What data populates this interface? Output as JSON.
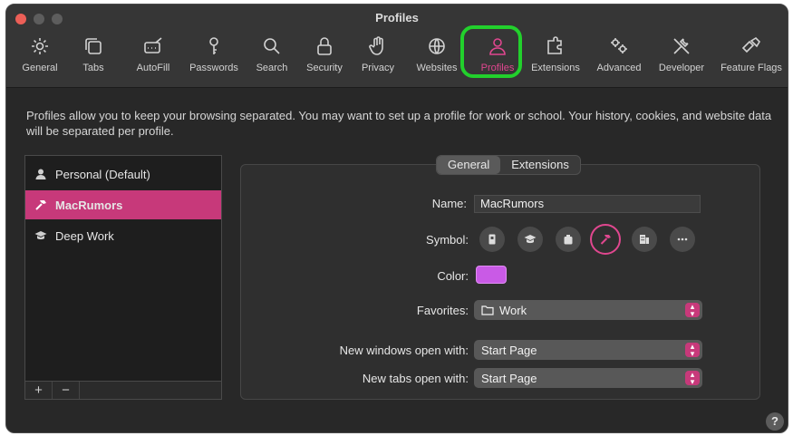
{
  "window": {
    "title": "Profiles"
  },
  "toolbar": {
    "items": [
      {
        "label": "General",
        "icon": "gear-icon"
      },
      {
        "label": "Tabs",
        "icon": "tabs-icon"
      },
      {
        "label": "AutoFill",
        "icon": "autofill-icon"
      },
      {
        "label": "Passwords",
        "icon": "key-icon"
      },
      {
        "label": "Search",
        "icon": "search-icon"
      },
      {
        "label": "Security",
        "icon": "lock-icon"
      },
      {
        "label": "Privacy",
        "icon": "hand-icon"
      },
      {
        "label": "Websites",
        "icon": "globe-icon"
      },
      {
        "label": "Profiles",
        "icon": "person-icon"
      },
      {
        "label": "Extensions",
        "icon": "puzzle-icon"
      },
      {
        "label": "Advanced",
        "icon": "gears-icon"
      },
      {
        "label": "Developer",
        "icon": "tools-icon"
      },
      {
        "label": "Feature Flags",
        "icon": "flags-icon"
      }
    ],
    "active": "Profiles"
  },
  "description": "Profiles allow you to keep your browsing separated. You may want to set up a profile for work or school. Your history, cookies, and website data will be separated per profile.",
  "sidebar": {
    "items": [
      {
        "label": "Personal (Default)",
        "icon": "person-icon"
      },
      {
        "label": "MacRumors",
        "icon": "hammer-icon"
      },
      {
        "label": "Deep Work",
        "icon": "graduation-cap-icon"
      }
    ],
    "selected": "MacRumors",
    "add_label": "+",
    "remove_label": "−"
  },
  "tabs": {
    "general": "General",
    "extensions": "Extensions",
    "active": "General"
  },
  "form": {
    "name_label": "Name:",
    "name_value": "MacRumors",
    "symbol_label": "Symbol:",
    "symbols": [
      "id-badge-icon",
      "graduation-cap-icon",
      "briefcase-icon",
      "hammer-icon",
      "building-icon",
      "more-icon"
    ],
    "selected_symbol": "hammer-icon",
    "color_label": "Color:",
    "color_value": "#c95ae6",
    "favorites_label": "Favorites:",
    "favorites_value": "Work",
    "new_windows_label": "New windows open with:",
    "new_windows_value": "Start Page",
    "new_tabs_label": "New tabs open with:",
    "new_tabs_value": "Start Page"
  },
  "help_label": "?",
  "colors": {
    "accent": "#c7397a",
    "highlight": "#22d02c",
    "active_tool": "#e0478f"
  }
}
